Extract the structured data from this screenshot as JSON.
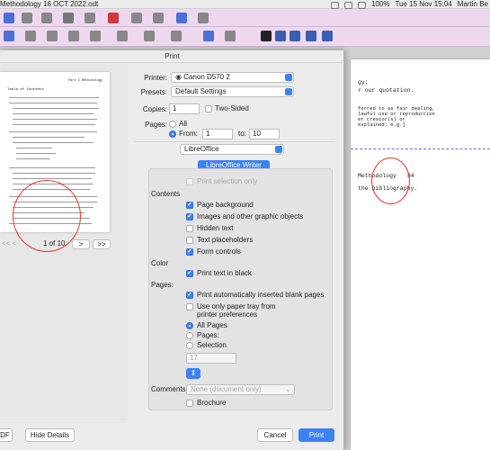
{
  "menubar": {
    "doc_title": "Methodology 16 OCT 2022.odt",
    "battery": "100%",
    "clock": "Tue 15 Nov  15:04",
    "user": "Martin Be"
  },
  "document": {
    "lines": [
      "gy;",
      "r our quotation.",
      "ferred to as fair dealing,",
      "lawful use or reproduction",
      "er creator(s) or",
      "explained; e.g.]",
      "Methodology",
      "84",
      "the bibliography."
    ]
  },
  "dialog": {
    "title": "Print",
    "preview": {
      "page_header": "Part 1 Methodology",
      "toc_title": "Table of Contents",
      "page_indicator": "1 of 10",
      "prev_label": "<<  <",
      "next_label": ">",
      "last_label": ">>"
    },
    "printer_label": "Printer:",
    "printer_value": "Canon D570 2",
    "presets_label": "Presets:",
    "presets_value": "Default Settings",
    "copies_label": "Copies:",
    "copies_value": "1",
    "two_sided_label": "Two-Sided",
    "pages_label": "Pages:",
    "all_label": "All",
    "from_label": "From:",
    "from_value": "1",
    "to_label": "to:",
    "to_value": "10",
    "app_section": "LibreOffice",
    "writer_tab": "LibreOffice Writer",
    "print_selection_only": "Print selection only",
    "contents_label": "Contents",
    "contents": [
      {
        "label": "Page background",
        "checked": true
      },
      {
        "label": "Images and other graphic objects",
        "checked": true
      },
      {
        "label": "Hidden text",
        "checked": false
      },
      {
        "label": "Text placeholders",
        "checked": false
      },
      {
        "label": "Form controls",
        "checked": true
      }
    ],
    "color_label": "Color",
    "print_black": "Print text in black",
    "pages_section_label": "Pages:",
    "blank_pages": "Print automatically inserted blank pages",
    "paper_tray_1": "Use only paper tray from",
    "paper_tray_2": "printer preferences",
    "page_options": [
      "All Pages",
      "Pages:",
      "Selection"
    ],
    "pages_input_placeholder": "17",
    "comments_label": "Comments",
    "comments_value": "None (document only)",
    "brochure_label": "Brochure",
    "pdf_label": "DF",
    "hide_details": "Hide Details",
    "cancel": "Cancel",
    "print": "Print"
  },
  "colors": {
    "accent": "#3b82f6",
    "toolbar": "#eed8f0",
    "annotation": "#e0352b"
  }
}
